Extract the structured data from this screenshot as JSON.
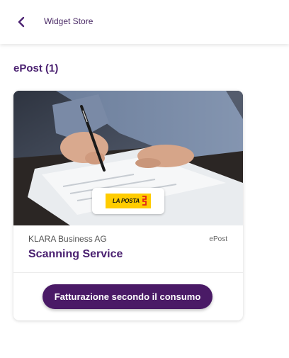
{
  "header": {
    "back_icon": "chevron-left-icon",
    "title": "Widget Store"
  },
  "section": {
    "title": "ePost (1)"
  },
  "widget_card": {
    "image": "hand-signing-document-photo",
    "logo_text": "LA POSTA",
    "company": "KLARA Business AG",
    "category": "ePost",
    "product_name": "Scanning Service",
    "billing_button_label": "Fatturazione secondo il consumo"
  },
  "colors": {
    "brand_purple": "#4a2070",
    "button_purple": "#4a1a66",
    "logo_yellow": "#ffcc00",
    "logo_red": "#e2231a"
  }
}
